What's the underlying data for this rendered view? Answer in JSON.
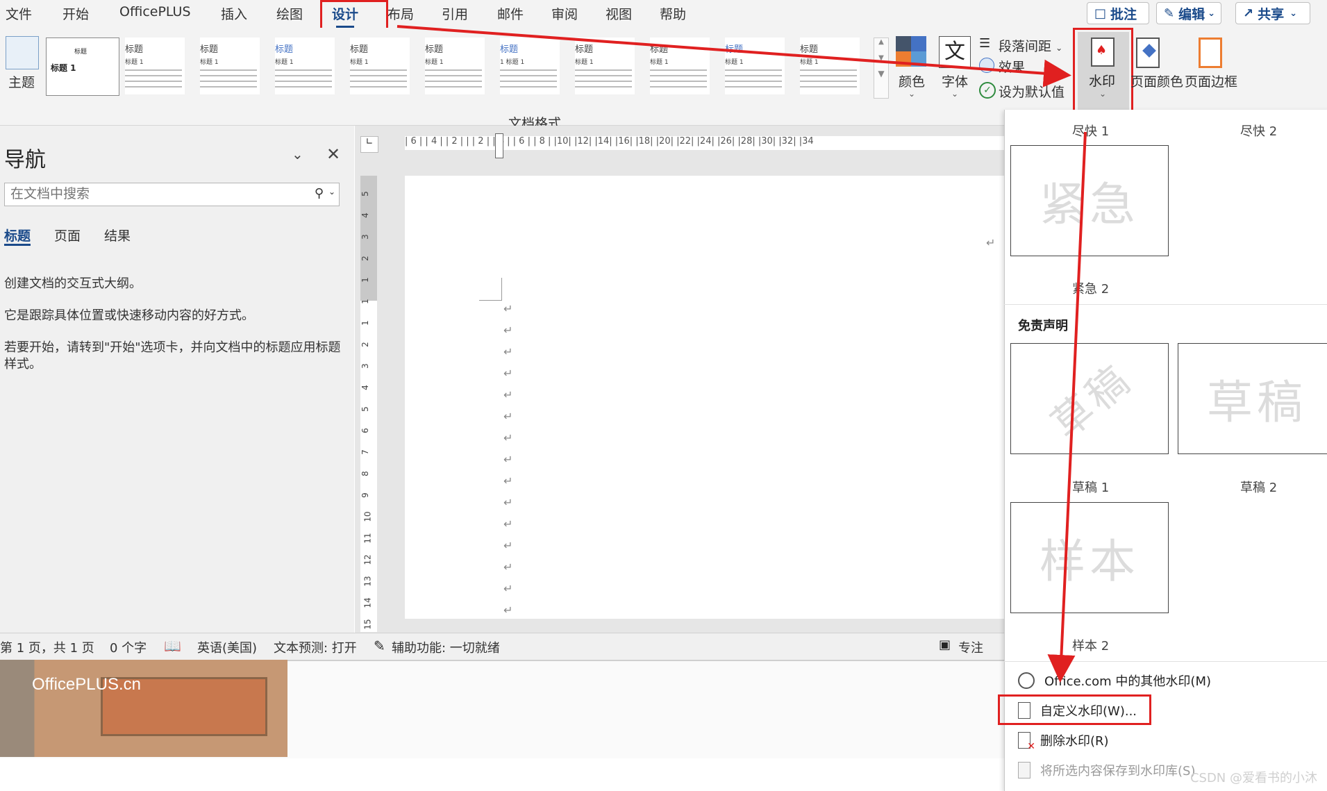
{
  "menubar": {
    "items": [
      "文件",
      "开始",
      "OfficePLUS",
      "插入",
      "绘图",
      "设计",
      "布局",
      "引用",
      "邮件",
      "审阅",
      "视图",
      "帮助"
    ],
    "active": "设计",
    "comment_label": "批注",
    "edit_label": "编辑",
    "share_label": "共享"
  },
  "ribbon": {
    "theme_label": "主题",
    "style_thumbs": [
      {
        "title": "标题",
        "sub": "标题 1"
      },
      {
        "title": "标题",
        "sub": "标题 1"
      },
      {
        "title": "标题",
        "sub": "标题 1"
      },
      {
        "title": "标题",
        "sub": "标题 1"
      },
      {
        "title": "标题",
        "sub": "标题 1"
      },
      {
        "title": "标题",
        "sub": "标题 1"
      },
      {
        "title": "标题",
        "sub": "1 标题 1"
      },
      {
        "title": "标题",
        "sub": "标题 1"
      },
      {
        "title": "标题",
        "sub": "标题 1"
      },
      {
        "title": "标题",
        "sub": "标题 1"
      },
      {
        "title": "标题",
        "sub": "标题 1"
      }
    ],
    "group_label": "文档格式",
    "colors_label": "颜色",
    "fonts_label": "字体",
    "font_icon": "文",
    "para_spacing_label": "段落间距",
    "effects_label": "效果",
    "set_default_label": "设为默认值",
    "watermark_label": "水印",
    "page_color_label": "页面颜色",
    "page_border_label": "页面边框"
  },
  "nav": {
    "title": "导航",
    "search_placeholder": "在文档中搜索",
    "tabs": [
      "标题",
      "页面",
      "结果"
    ],
    "active_tab": "标题",
    "text1": "创建文档的交互式大纲。",
    "text2": "它是跟踪具体位置或快速移动内容的好方式。",
    "text3": "若要开始，请转到\"开始\"选项卡，并向文档中的标题应用标题样式。"
  },
  "ruler": {
    "h_ticks": "| 6 |  | 4 |  | 2 |  |  | 2 |  | 4 |  | 6 |  | 8 |  |10|  |12|  |14|  |16|  |18|  |20|  |22|  |24|  |26|  |28|  |30|  |32|  |34",
    "v_ticks": [
      "5",
      "4",
      "3",
      "2",
      "1",
      "1",
      "1",
      "2",
      "3",
      "4",
      "5",
      "6",
      "7",
      "8",
      "9",
      "10",
      "11",
      "12",
      "13",
      "14",
      "15"
    ]
  },
  "status": {
    "page": "第 1 页，共 1 页",
    "words": "0 个字",
    "language": "英语(美国)",
    "prediction": "文本预测: 打开",
    "accessibility": "辅助功能: 一切就绪",
    "focus": "专注"
  },
  "banner": {
    "text": "OfficePLUS.cn"
  },
  "watermark_panel": {
    "items_top": [
      {
        "label": "尽快 1"
      },
      {
        "label": "尽快 2"
      }
    ],
    "urgent_text": "紧急",
    "urgent2_label": "紧急 2",
    "section": "免责声明",
    "draft1_text": "草稿",
    "draft1_label": "草稿 1",
    "draft2_text": "草稿",
    "draft2_label": "草稿 2",
    "sample_text": "样本",
    "sample2_label": "样本 2",
    "cmd_more": "Office.com 中的其他水印(M)",
    "cmd_custom": "自定义水印(W)...",
    "cmd_remove": "删除水印(R)",
    "cmd_save": "将所选内容保存到水印库(S)"
  },
  "credit": "CSDN @爱看书的小沐",
  "colors": {
    "accent": "#1a4a8a",
    "annotation_red": "#e02020"
  }
}
